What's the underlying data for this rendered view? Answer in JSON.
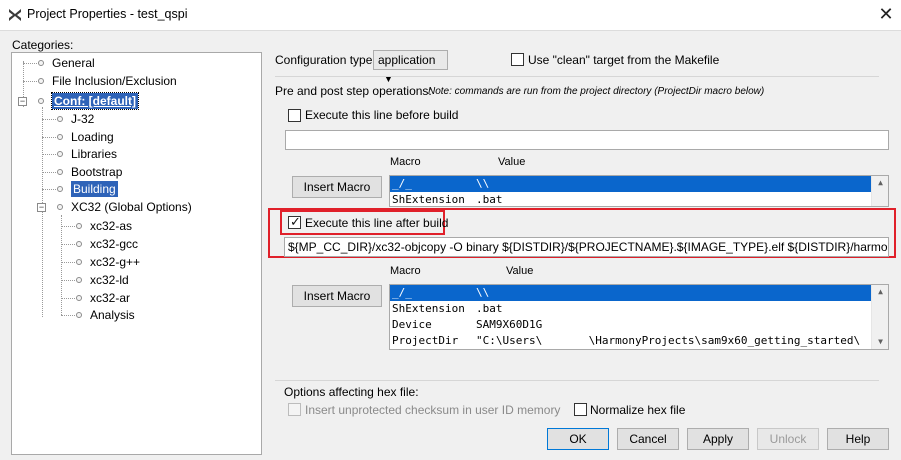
{
  "window": {
    "title": "Project Properties - test_qspi",
    "close_glyph": "✕"
  },
  "categories": {
    "label": "Categories:",
    "items": [
      {
        "label": "General"
      },
      {
        "label": "File Inclusion/Exclusion"
      },
      {
        "label": "Conf: [default]"
      },
      {
        "label": "J-32"
      },
      {
        "label": "Loading"
      },
      {
        "label": "Libraries"
      },
      {
        "label": "Bootstrap"
      },
      {
        "label": "Building"
      },
      {
        "label": "XC32 (Global Options)"
      },
      {
        "label": "xc32-as"
      },
      {
        "label": "xc32-gcc"
      },
      {
        "label": "xc32-g++"
      },
      {
        "label": "xc32-ld"
      },
      {
        "label": "xc32-ar"
      },
      {
        "label": "Analysis"
      }
    ],
    "expander_glyph": "−"
  },
  "config": {
    "type_label": "Configuration type:",
    "type_value": "application",
    "clean_label": "Use \"clean\" target from the Makefile"
  },
  "prepost": {
    "label": "Pre and post step operations:",
    "note": "Note: commands are run from the project directory (ProjectDir macro below)",
    "before_label": "Execute this line before build",
    "before_value": "",
    "after_label": "Execute this line after build",
    "after_value": "${MP_CC_DIR}/xc32-objcopy -O binary ${DISTDIR}/${PROJECTNAME}.${IMAGE_TYPE}.elf ${DISTDIR}/harmony.bin"
  },
  "macros": {
    "col_macro": "Macro",
    "col_value": "Value",
    "insert_label": "Insert Macro",
    "list1": [
      {
        "macro": "_/_",
        "value": "\\\\"
      },
      {
        "macro": "ShExtension",
        "value": ".bat"
      }
    ],
    "list2": [
      {
        "macro": "_/_",
        "value": "\\\\"
      },
      {
        "macro": "ShExtension",
        "value": ".bat"
      },
      {
        "macro": "Device",
        "value": "SAM9X60D1G"
      },
      {
        "macro": "ProjectDir",
        "value": "\"C:\\Users\\       \\HarmonyProjects\\sam9x60_getting_started\\"
      }
    ]
  },
  "hex": {
    "label": "Options affecting hex file:",
    "checksum_label": "Insert unprotected checksum in user ID memory",
    "normalize_label": "Normalize hex file"
  },
  "buttons": {
    "ok": "OK",
    "cancel": "Cancel",
    "apply": "Apply",
    "unlock": "Unlock",
    "help": "Help"
  },
  "colors": {
    "selection": "#0a66cc",
    "highlight_box": "#e0202a"
  }
}
